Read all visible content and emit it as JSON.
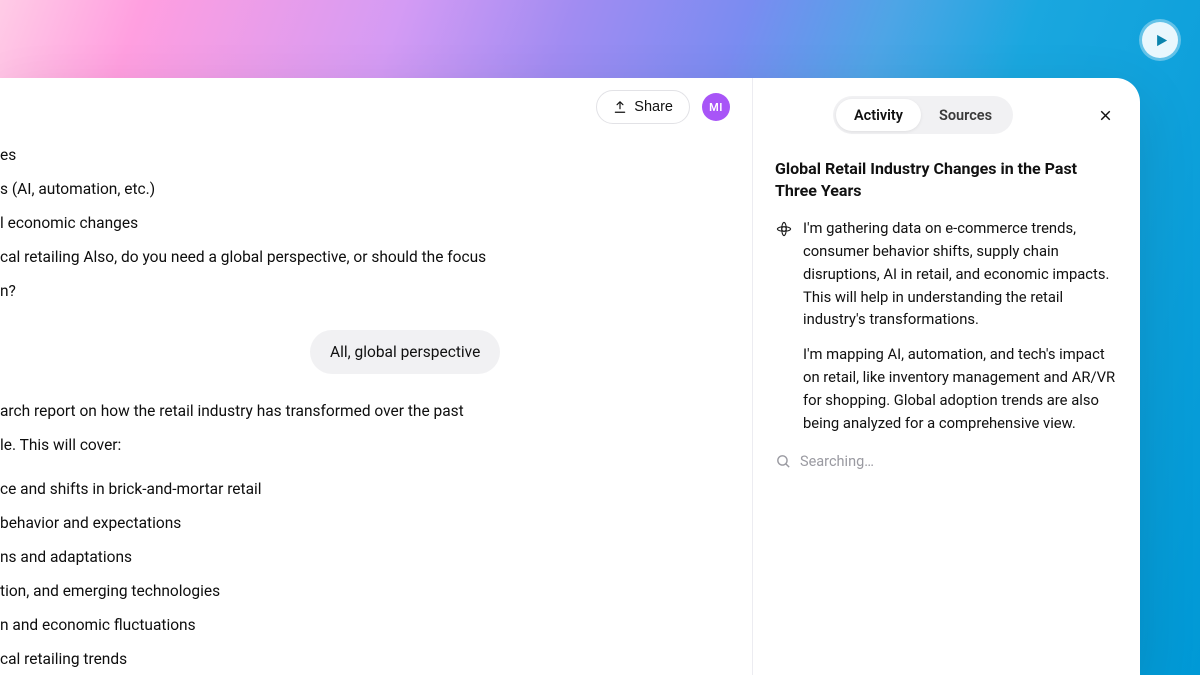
{
  "header": {
    "share_label": "Share",
    "avatar_initials": "MI"
  },
  "tabs": {
    "activity": "Activity",
    "sources": "Sources"
  },
  "sidebar": {
    "title": "Global Retail Industry Changes in the Past Three Years",
    "para1": "I'm gathering data on e-commerce trends, consumer behavior shifts, supply chain disruptions, AI in retail, and economic impacts. This will help in understanding the retail industry's transformations.",
    "para2": "I'm mapping AI, automation, and tech's impact on retail, like inventory management and AR/VR for shopping. Global adoption trends are also being analyzed for a comprehensive view.",
    "searching": "Searching…"
  },
  "conv": {
    "l1": "es",
    "l2": "s (AI, automation, etc.)",
    "l3": "l economic changes",
    "l4": "cal retailing Also, do you need a global perspective, or should the focus",
    "l5": "n?",
    "user_reply": "All, global perspective",
    "l6": "arch report on how the retail industry has transformed over the past",
    "l7": "le. This will cover:",
    "l8": "ce and shifts in brick-and-mortar retail",
    "l9": " behavior and expectations",
    "l10": "ns and adaptations",
    "l11": "tion, and emerging technologies",
    "l12": "n and economic fluctuations",
    "l13": "cal retailing trends"
  }
}
